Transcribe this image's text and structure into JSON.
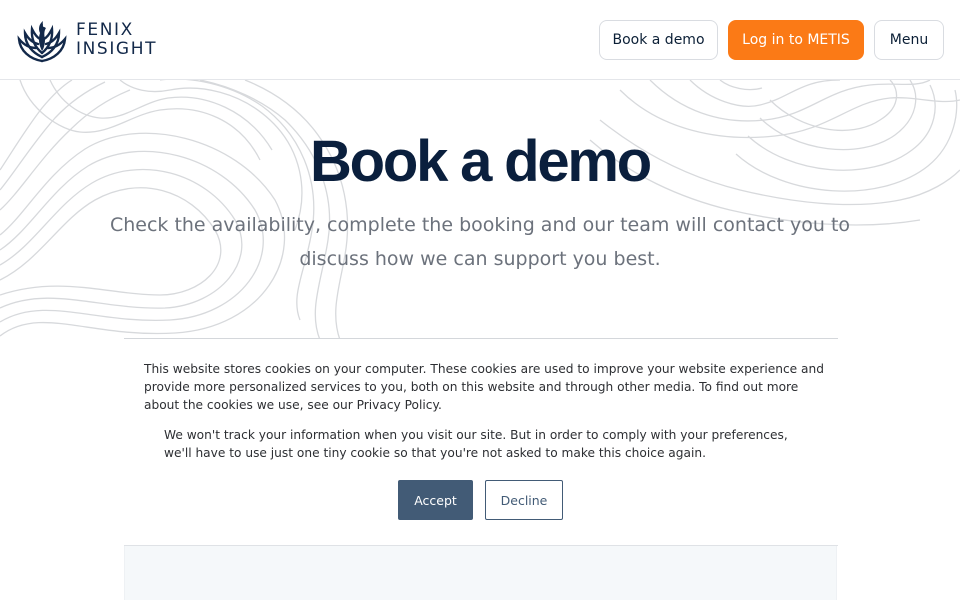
{
  "header": {
    "logo_line1": "FENIX",
    "logo_line2": "INSIGHT",
    "book_demo_label": "Book a demo",
    "login_label": "Log in to METIS",
    "menu_label": "Menu"
  },
  "hero": {
    "title": "Book a demo",
    "subtitle": "Check the availability, complete the booking and our team will contact you to discuss how we can support you best."
  },
  "cookie_banner": {
    "text_primary": "This website stores cookies on your computer. These cookies are used to improve your website experience and provide more personalized services to you, both on this website and through other media. To find out more about the cookies we use, see our Privacy Policy.",
    "text_secondary": "We won't track your information when you visit our site. But in order to comply with your preferences, we'll have to use just one tiny cookie so that you're not asked to make this choice again.",
    "accept_label": "Accept",
    "decline_label": "Decline"
  },
  "colors": {
    "brand_navy": "#0a1f3d",
    "accent_orange": "#fb7a16",
    "cookie_button": "#425b76",
    "topo_lines": "#d7d9dc"
  },
  "icons": {
    "logo": "phoenix-logo-icon"
  }
}
